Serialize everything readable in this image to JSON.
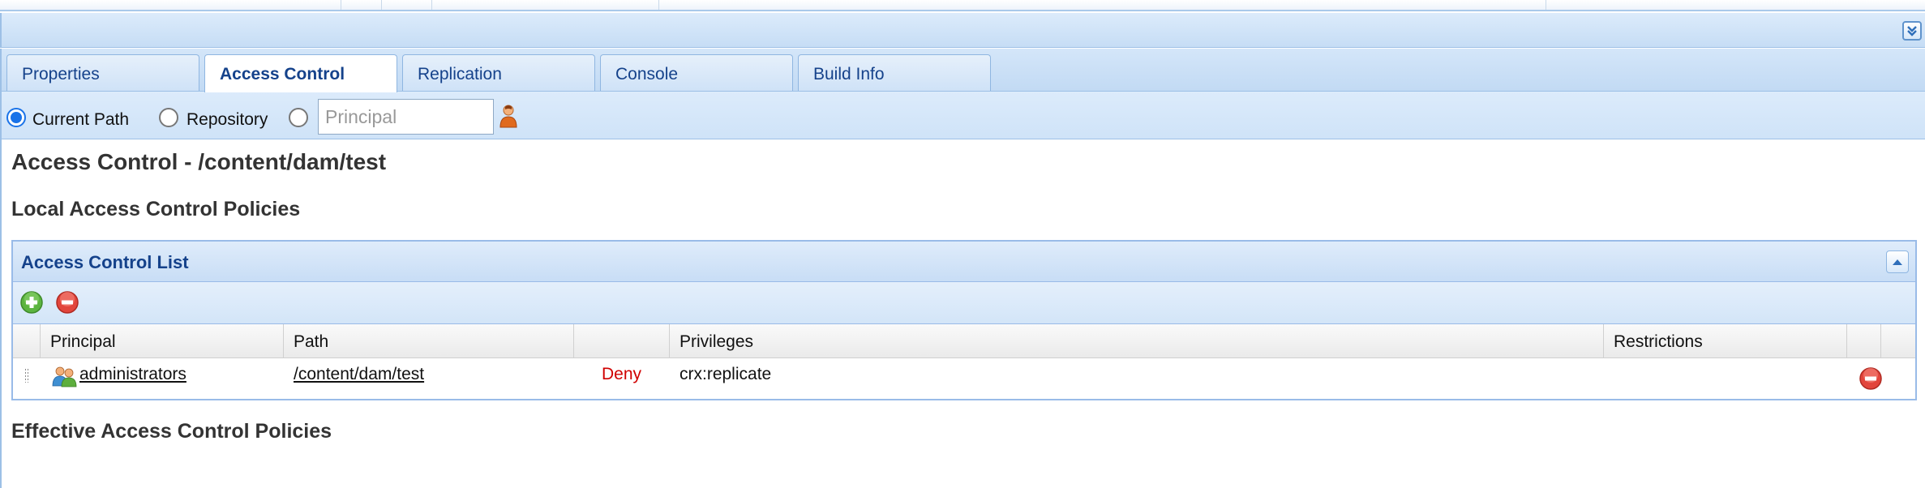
{
  "tabs": [
    {
      "label": "Properties",
      "active": false
    },
    {
      "label": "Access Control",
      "active": true
    },
    {
      "label": "Replication",
      "active": false
    },
    {
      "label": "Console",
      "active": false
    },
    {
      "label": "Build Info",
      "active": false
    }
  ],
  "filter": {
    "options": [
      {
        "label": "Current Path",
        "checked": true
      },
      {
        "label": "Repository",
        "checked": false
      },
      {
        "label": "",
        "checked": false
      }
    ],
    "principal_placeholder": "Principal",
    "principal_value": ""
  },
  "page": {
    "title": "Access Control - /content/dam/test",
    "local_heading": "Local Access Control Policies",
    "effective_heading": "Effective Access Control Policies"
  },
  "acl": {
    "title": "Access Control List",
    "columns": [
      "Principal",
      "Path",
      "",
      "Privileges",
      "Restrictions",
      ""
    ],
    "rows": [
      {
        "principal": "administrators",
        "path": "/content/dam/test",
        "type": "Deny",
        "privileges": "crx:replicate",
        "restrictions": ""
      }
    ]
  },
  "icons": {
    "collapse": "double-chevron-down-icon",
    "acl_collapse": "chevron-up-icon",
    "add": "add-green-icon",
    "remove": "remove-red-icon",
    "user": "user-icon",
    "group": "group-icon"
  },
  "colors": {
    "accent": "#15428b",
    "deny": "#d00000",
    "panel_border": "#99bbe8",
    "radio_selected": "#1a73e8"
  }
}
